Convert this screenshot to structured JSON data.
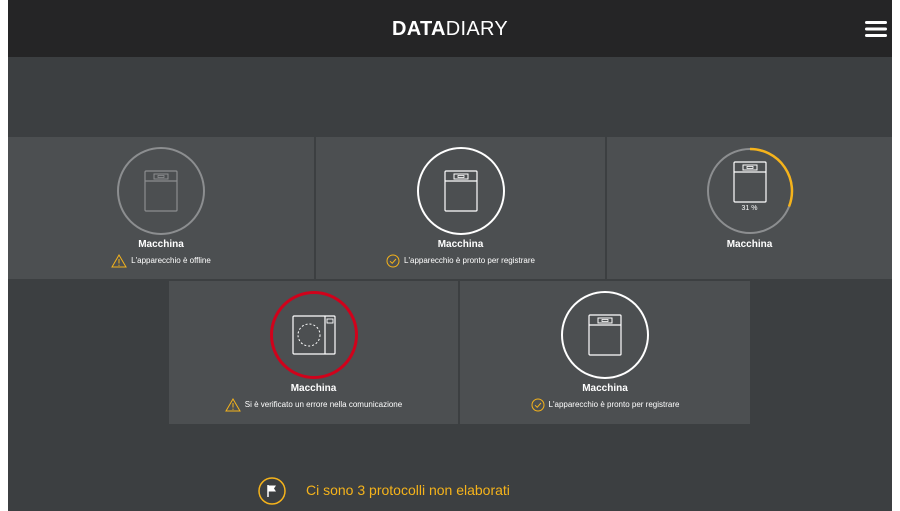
{
  "header": {
    "brand_bold": "DATA",
    "brand_light": "DIARY",
    "menu_icon": "hamburger-menu-icon"
  },
  "devices": [
    {
      "title": "Macchina",
      "status": "L'apparecchio è offline",
      "state": "offline",
      "status_icon": "warning-icon"
    },
    {
      "title": "Macchina",
      "status": "L'apparecchio è pronto per registrare",
      "state": "ready",
      "status_icon": "check-circle-icon"
    },
    {
      "title": "Macchina",
      "status": "",
      "state": "recording",
      "progress_label": "31 %",
      "progress": 0.31
    },
    {
      "title": "Macchina",
      "status": "Si è verificato un errore nella comunicazione",
      "state": "error",
      "status_icon": "warning-icon"
    },
    {
      "title": "Macchina",
      "status": "L'apparecchio è pronto per registrare",
      "state": "ready",
      "status_icon": "check-circle-icon"
    }
  ],
  "footer": {
    "message": "Ci sono 3 protocolli non elaborati",
    "icon": "flag-icon"
  },
  "colors": {
    "background": "#3c3f41",
    "header": "#252526",
    "tile": "#4c4f51",
    "accent": "#f5b31b",
    "error": "#d0021b",
    "offline_ring": "#8c8e90"
  }
}
